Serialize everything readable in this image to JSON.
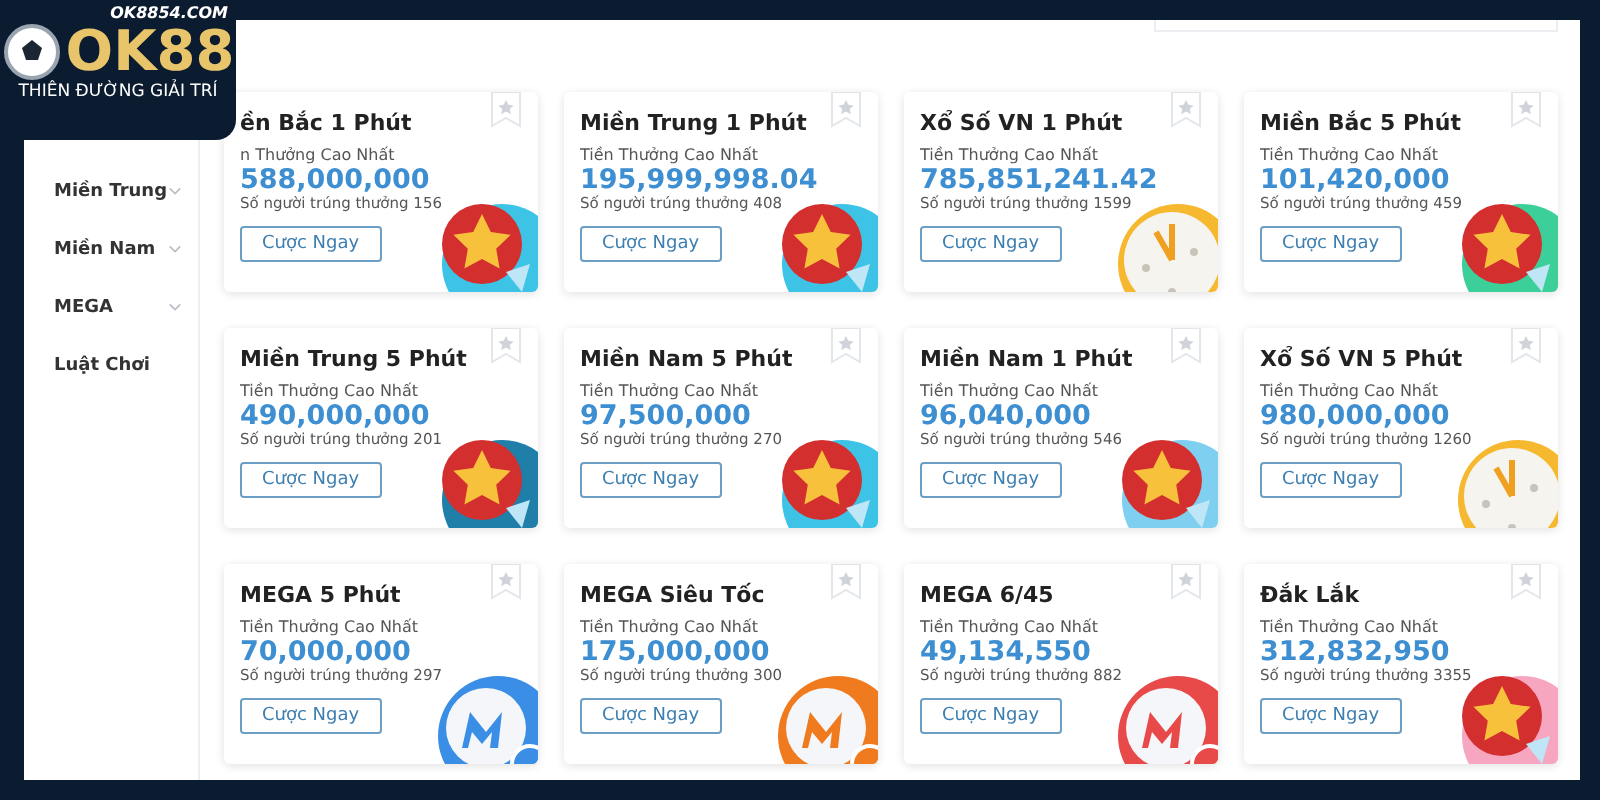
{
  "logo": {
    "domain": "OK8854.COM",
    "brand": "OK88",
    "tagline": "THIÊN ĐƯỜNG GIẢI TRÍ"
  },
  "sidebar": {
    "items": [
      {
        "label": "Miền Trung",
        "expandable": true
      },
      {
        "label": "Miền Nam",
        "expandable": true
      },
      {
        "label": "MEGA",
        "expandable": true
      },
      {
        "label": "Luật Chơi",
        "expandable": false
      }
    ]
  },
  "games": [
    {
      "title": "ền Bắc 1 Phút",
      "prize_label": "n Thưởng Cao Nhất",
      "prize": "588,000,000",
      "winners": "Số người trúng thưởng 156",
      "button": "Cược Ngay",
      "art": {
        "kind": "star",
        "color": "#3cc3e6"
      }
    },
    {
      "title": "Miền Trung 1 Phút",
      "prize_label": "Tiền Thưởng Cao Nhất",
      "prize": "195,999,998.04",
      "winners": "Số người trúng thưởng 408",
      "button": "Cược Ngay",
      "art": {
        "kind": "star",
        "color": "#3cc3e6"
      }
    },
    {
      "title": "Xổ Số VN 1 Phút",
      "prize_label": "Tiền Thưởng Cao Nhất",
      "prize": "785,851,241.42",
      "winners": "Số người trúng thưởng 1599",
      "button": "Cược Ngay",
      "art": {
        "kind": "clock",
        "color": "#f5b82e"
      }
    },
    {
      "title": "Miền Bắc 5 Phút",
      "prize_label": "Tiền Thưởng Cao Nhất",
      "prize": "101,420,000",
      "winners": "Số người trúng thưởng 459",
      "button": "Cược Ngay",
      "art": {
        "kind": "star",
        "color": "#3ccf9a"
      }
    },
    {
      "title": "Miền Trung 5 Phút",
      "prize_label": "Tiền Thưởng Cao Nhất",
      "prize": "490,000,000",
      "winners": "Số người trúng thưởng 201",
      "button": "Cược Ngay",
      "art": {
        "kind": "star",
        "color": "#1f7fa8"
      }
    },
    {
      "title": "Miền Nam 5 Phút",
      "prize_label": "Tiền Thưởng Cao Nhất",
      "prize": "97,500,000",
      "winners": "Số người trúng thưởng 270",
      "button": "Cược Ngay",
      "art": {
        "kind": "star",
        "color": "#3cc3e6"
      }
    },
    {
      "title": "Miền Nam 1 Phút",
      "prize_label": "Tiền Thưởng Cao Nhất",
      "prize": "96,040,000",
      "winners": "Số người trúng thưởng 546",
      "button": "Cược Ngay",
      "art": {
        "kind": "star",
        "color": "#7fd0f0"
      }
    },
    {
      "title": "Xổ Số VN 5 Phút",
      "prize_label": "Tiền Thưởng Cao Nhất",
      "prize": "980,000,000",
      "winners": "Số người trúng thưởng 1260",
      "button": "Cược Ngay",
      "art": {
        "kind": "clock",
        "color": "#f5b82e"
      }
    },
    {
      "title": "MEGA 5 Phút",
      "prize_label": "Tiền Thưởng Cao Nhất",
      "prize": "70,000,000",
      "winners": "Số người trúng thưởng 297",
      "button": "Cược Ngay",
      "art": {
        "kind": "mega",
        "color": "#3a8ee6"
      }
    },
    {
      "title": "MEGA Siêu Tốc",
      "prize_label": "Tiền Thưởng Cao Nhất",
      "prize": "175,000,000",
      "winners": "Số người trúng thưởng 300",
      "button": "Cược Ngay",
      "art": {
        "kind": "mega",
        "color": "#f07a1e"
      }
    },
    {
      "title": "MEGA 6/45",
      "prize_label": "Tiền Thưởng Cao Nhất",
      "prize": "49,134,550",
      "winners": "Số người trúng thưởng 882",
      "button": "Cược Ngay",
      "art": {
        "kind": "mega",
        "color": "#e84a4a"
      }
    },
    {
      "title": "Đắk Lắk",
      "prize_label": "Tiền Thưởng Cao Nhất",
      "prize": "312,832,950",
      "winners": "Số người trúng thưởng 3355",
      "button": "Cược Ngay",
      "art": {
        "kind": "star",
        "color": "#f7a6c0"
      }
    }
  ]
}
